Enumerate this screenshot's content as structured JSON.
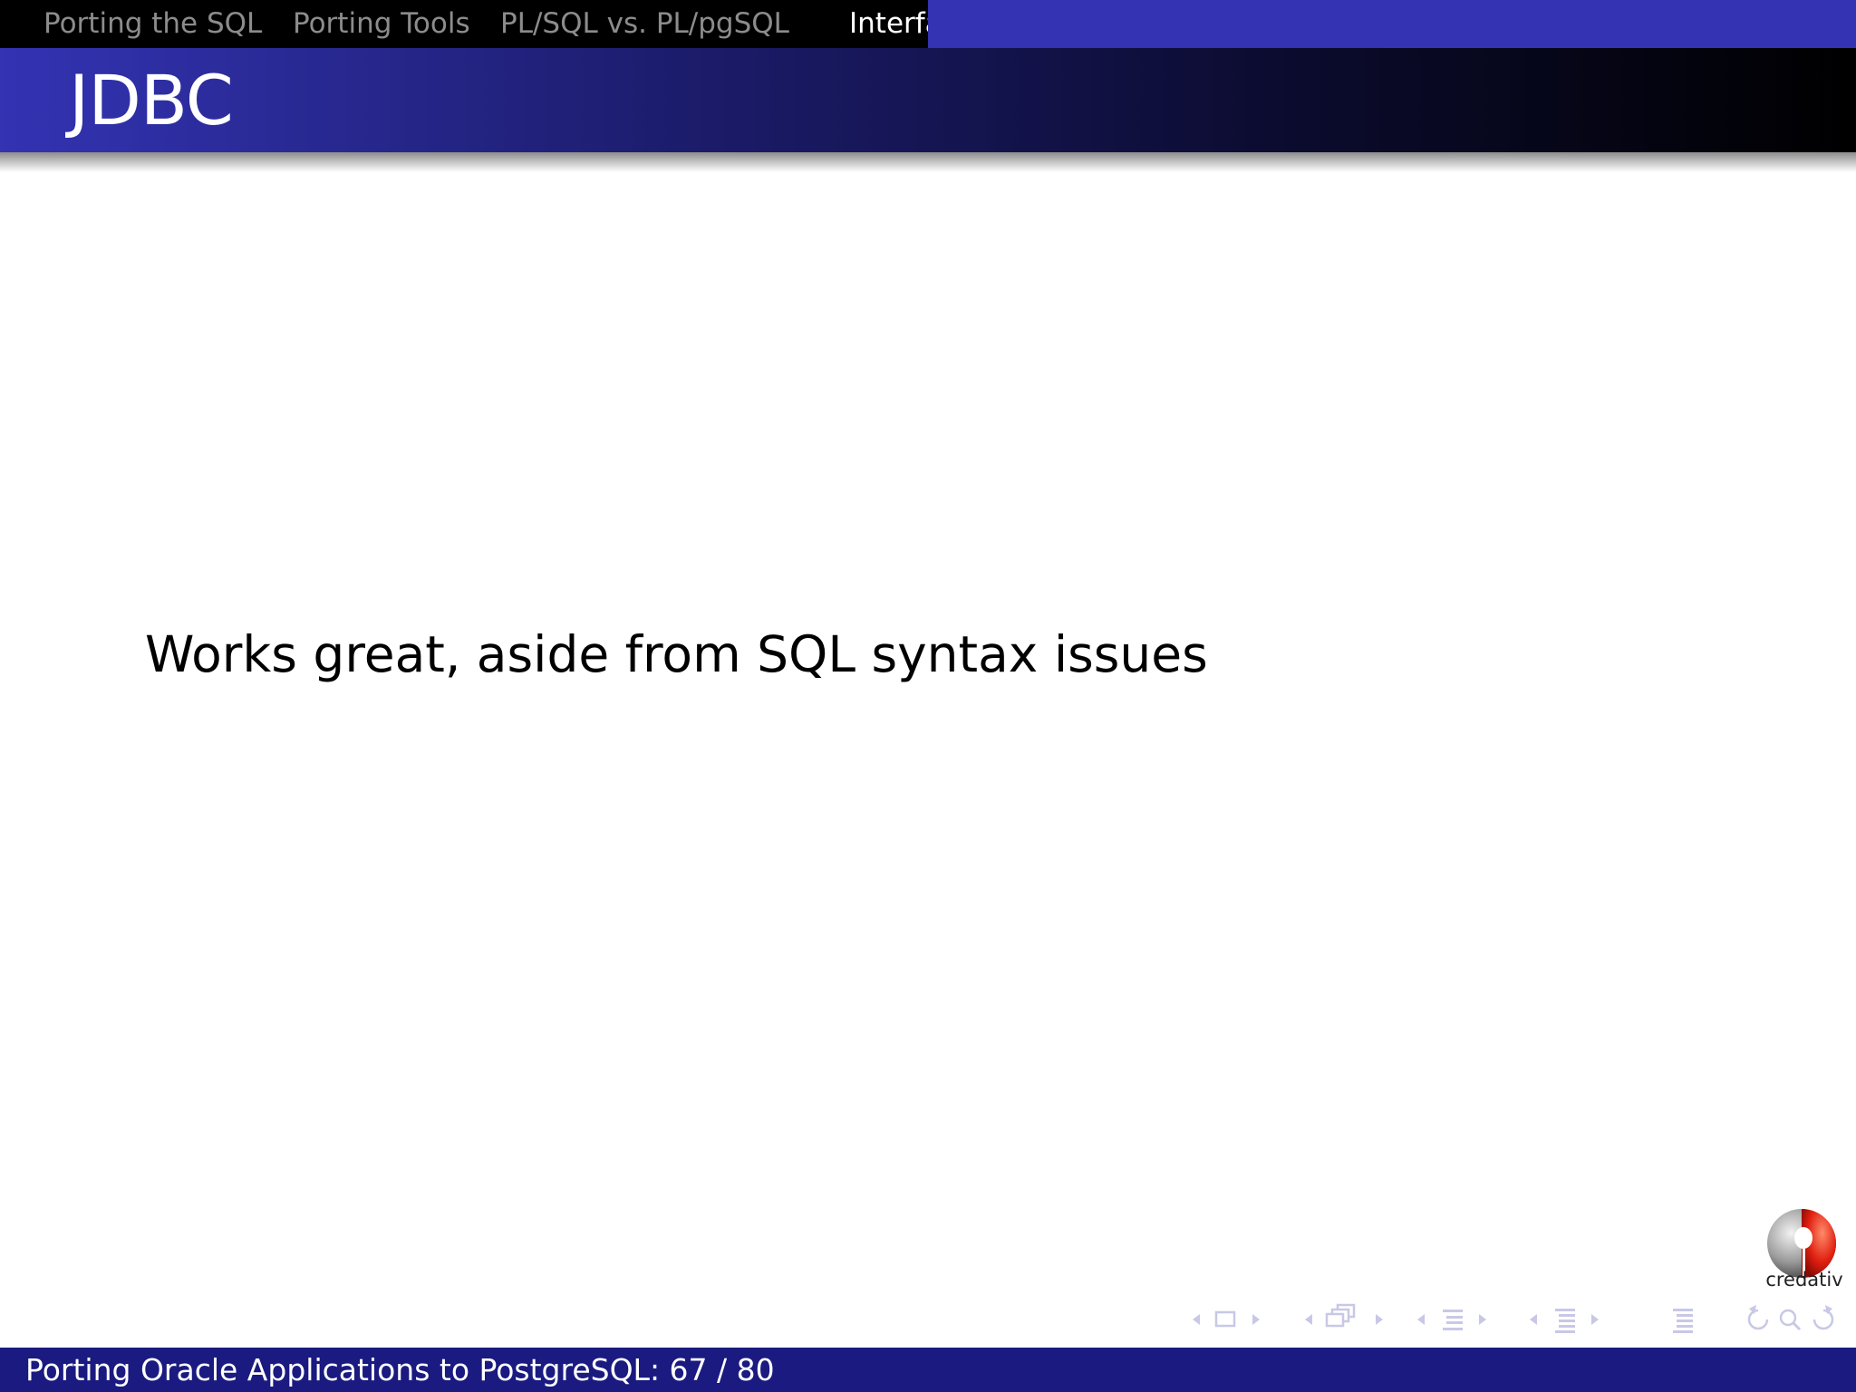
{
  "nav": {
    "sections": [
      {
        "label": "Porting the SQL",
        "current": false
      },
      {
        "label": "Porting Tools",
        "current": false
      },
      {
        "label": "PL/SQL vs. PL/pgSQL",
        "current": false
      },
      {
        "label": "Interfa",
        "current": true
      }
    ]
  },
  "frame": {
    "title": "JDBC",
    "body": "Works great, aside from SQL syntax issues"
  },
  "logo": {
    "text": "credativ"
  },
  "footer": {
    "text": "Porting Oracle Applications to PostgreSQL: 67 / 80"
  },
  "colors": {
    "nav_background": "#000000",
    "theme_blue": "#3333b3",
    "footer_blue": "#1a1a80",
    "nav_symbols": "#c8c8e6"
  },
  "beamer_nav_icons": [
    "slide-nav-icon",
    "frame-nav-icon",
    "subsection-nav-icon",
    "section-nav-icon",
    "document-nav-icon",
    "back-icon",
    "search-icon",
    "forward-icon"
  ]
}
